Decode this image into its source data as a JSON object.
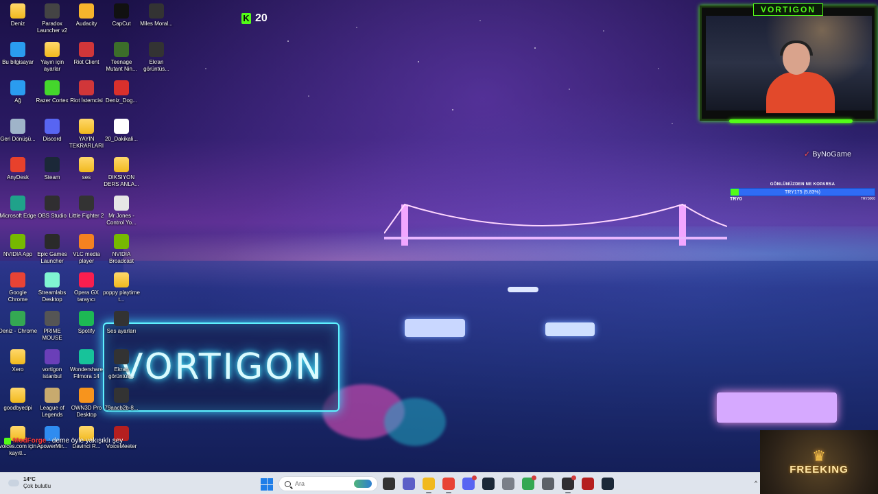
{
  "desktop_icons": [
    {
      "label": "Deniz",
      "icon": "folder-icon",
      "color": "#f1b91e"
    },
    {
      "label": "Bu bilgisayar",
      "icon": "this-pc-icon",
      "color": "#2a9cf0"
    },
    {
      "label": "Ağ",
      "icon": "network-icon",
      "color": "#2a9cf0"
    },
    {
      "label": "Geri Dönüşü...",
      "icon": "recycle-bin-icon",
      "color": "#9fb4c9"
    },
    {
      "label": "AnyDesk",
      "icon": "anydesk-icon",
      "color": "#e8412c"
    },
    {
      "label": "Microsoft Edge",
      "icon": "edge-icon",
      "color": "#1fa28a"
    },
    {
      "label": "NVIDIA App",
      "icon": "nvidia-icon",
      "color": "#76b900"
    },
    {
      "label": "Google Chrome",
      "icon": "chrome-icon",
      "color": "#e84335"
    },
    {
      "label": "Deniz - Chrome",
      "icon": "chrome-icon",
      "color": "#34a853"
    },
    {
      "label": "Xero",
      "icon": "folder-icon",
      "color": "#f1b91e"
    },
    {
      "label": "goodbyedpi",
      "icon": "folder-icon",
      "color": "#f1b91e"
    },
    {
      "label": "voices.com için kayıtl...",
      "icon": "folder-icon",
      "color": "#f1b91e"
    },
    {
      "label": "Paradox Launcher v2",
      "icon": "paradox-icon",
      "color": "#444444"
    },
    {
      "label": "Yayın için ayarlar",
      "icon": "folder-icon",
      "color": "#f1b91e"
    },
    {
      "label": "Razer Cortex",
      "icon": "razer-icon",
      "color": "#44d62c"
    },
    {
      "label": "Discord",
      "icon": "discord-icon",
      "color": "#5865f2"
    },
    {
      "label": "Steam",
      "icon": "steam-icon",
      "color": "#1b2838"
    },
    {
      "label": "OBS Studio",
      "icon": "obs-icon",
      "color": "#302e31"
    },
    {
      "label": "Epic Games Launcher",
      "icon": "epic-icon",
      "color": "#2a2a2a"
    },
    {
      "label": "Streamlabs Desktop",
      "icon": "streamlabs-icon",
      "color": "#80f5d2"
    },
    {
      "label": "PRIME MOUSE",
      "icon": "mouse-icon",
      "color": "#555555"
    },
    {
      "label": "vortigon istanbul",
      "icon": "image-icon",
      "color": "#6a3fb8"
    },
    {
      "label": "League of Legends",
      "icon": "lol-icon",
      "color": "#c8aa6e"
    },
    {
      "label": "ApowerMir...",
      "icon": "apowermirror-icon",
      "color": "#2f8cf0"
    },
    {
      "label": "Audacity",
      "icon": "audacity-icon",
      "color": "#f6b42c"
    },
    {
      "label": "Riot Client",
      "icon": "riot-icon",
      "color": "#d13639"
    },
    {
      "label": "Riot İstemcisi",
      "icon": "riot-icon",
      "color": "#d13639"
    },
    {
      "label": "YAYIN TEKRARLARI",
      "icon": "folder-icon",
      "color": "#f1b91e"
    },
    {
      "label": "ses",
      "icon": "folder-icon",
      "color": "#f1b91e"
    },
    {
      "label": "Little Fighter 2",
      "icon": "little-fighter-icon",
      "color": "#333333"
    },
    {
      "label": "VLC media player",
      "icon": "vlc-icon",
      "color": "#f58220"
    },
    {
      "label": "Opera GX tarayıcı",
      "icon": "opera-gx-icon",
      "color": "#fa1e4e"
    },
    {
      "label": "Spotify",
      "icon": "spotify-icon",
      "color": "#1db954"
    },
    {
      "label": "Wondershare Filmora 14",
      "icon": "filmora-icon",
      "color": "#17c39a"
    },
    {
      "label": "OWN3D Pro Desktop",
      "icon": "own3d-icon",
      "color": "#f7941d"
    },
    {
      "label": "Davinci R...",
      "icon": "folder-icon",
      "color": "#f1b91e"
    },
    {
      "label": "CapCut",
      "icon": "capcut-icon",
      "color": "#111111"
    },
    {
      "label": "Teenage Mutant Nin...",
      "icon": "game-icon",
      "color": "#3c6e2a"
    },
    {
      "label": "Deniz_Dog...",
      "icon": "pdf-icon",
      "color": "#d9302c"
    },
    {
      "label": "20_Dakikali...",
      "icon": "file-icon",
      "color": "#ffffff"
    },
    {
      "label": "DIKSIYON DERS ANLA...",
      "icon": "folder-icon",
      "color": "#f1b91e"
    },
    {
      "label": "Mr Jones - Control Yo...",
      "icon": "audio-file-icon",
      "color": "#e6e6e6"
    },
    {
      "label": "NVIDIA Broadcast",
      "icon": "nvidia-broadcast-icon",
      "color": "#76b900"
    },
    {
      "label": "poppy playtime t...",
      "icon": "folder-icon",
      "color": "#f1b91e"
    },
    {
      "label": "Ses ayarları",
      "icon": "image-icon",
      "color": "#333333"
    },
    {
      "label": "Ekran görüntüs...",
      "icon": "image-icon",
      "color": "#333333"
    },
    {
      "label": "79aacb2b-8...",
      "icon": "image-icon",
      "color": "#333333"
    },
    {
      "label": "VoiceMeeter",
      "icon": "voicemeeter-icon",
      "color": "#b51f1f"
    },
    {
      "label": "Miles Moral...",
      "icon": "image-icon",
      "color": "#333333"
    },
    {
      "label": "Ekran görüntüs...",
      "icon": "image-icon",
      "color": "#333333"
    }
  ],
  "wallpaper": {
    "sign_text": "VORTIGON"
  },
  "kick_counter": {
    "value": "20",
    "icon": "kick-icon",
    "color": "#53fc18"
  },
  "webcam": {
    "brand": "VORTIGON"
  },
  "stream_logo": {
    "text": "ByNoGame",
    "icon": "bynogame-icon"
  },
  "donation_goal": {
    "title": "GÖNLÜNÜZDEN NE KOPARSA",
    "progress_text": "TRY175 (5.83%)",
    "progress_percent": 5.83,
    "start_label": "TRY0",
    "end_label": "TRY3000"
  },
  "chat": {
    "username": "ModForge",
    "message": ": deme öyle yakışıklı şey"
  },
  "freeking": {
    "name": "FREEKING"
  },
  "taskbar": {
    "weather": {
      "temp": "14°C",
      "condition": "Çok bulutlu"
    },
    "search_placeholder": "Ara",
    "apps": [
      {
        "name": "task-view-icon",
        "color": "#333333"
      },
      {
        "name": "teams-icon",
        "color": "#5b5fc7"
      },
      {
        "name": "file-explorer-icon",
        "color": "#f1b91e"
      },
      {
        "name": "chrome-icon",
        "color": "#e84335"
      },
      {
        "name": "discord-icon",
        "color": "#5865f2"
      },
      {
        "name": "steam-icon",
        "color": "#1b2838"
      },
      {
        "name": "paint-icon",
        "color": "#7a7f88"
      },
      {
        "name": "chrome-icon",
        "color": "#34a853"
      },
      {
        "name": "settings-icon",
        "color": "#5c6168"
      },
      {
        "name": "obs-icon",
        "color": "#302e31"
      },
      {
        "name": "voicemeeter-icon",
        "color": "#b51f1f"
      },
      {
        "name": "steam-icon",
        "color": "#1b2838"
      }
    ]
  }
}
